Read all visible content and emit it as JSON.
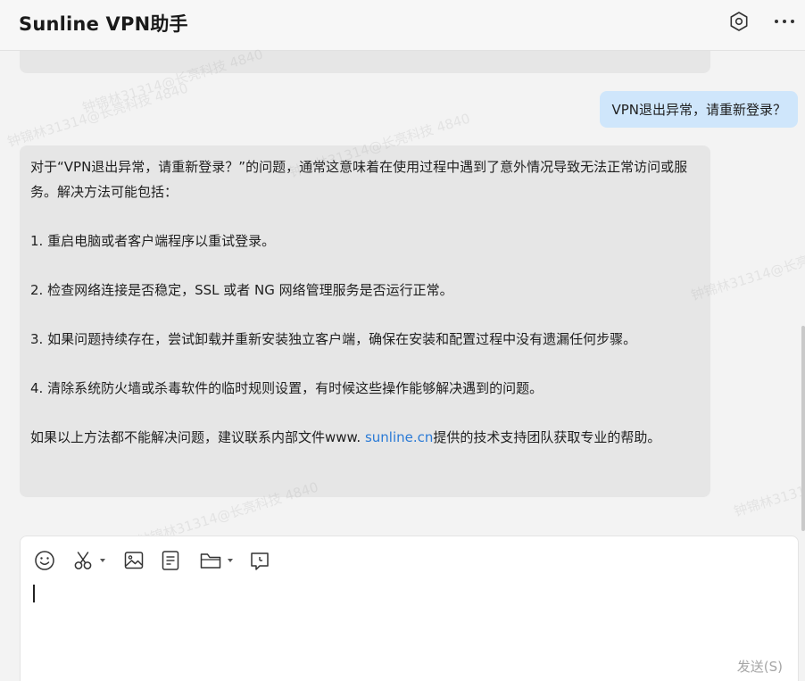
{
  "header": {
    "title": "Sunline VPN助手"
  },
  "watermark": {
    "text_a": "钟锦林31314@长亮科技 4840",
    "text_b": "钟锦林31314@长亮科技 4840"
  },
  "chat": {
    "user_message": "VPN退出异常，请重新登录？",
    "bot_reply": {
      "intro": "对于“VPN退出异常，请重新登录？”的问题，通常这意味着在使用过程中遇到了意外情况导致无法正常访问或服务。解决方法可能包括：",
      "step1": "1. 重启电脑或者客户端程序以重试登录。",
      "step2": "2. 检查网络连接是否稳定，SSL 或者 NG 网络管理服务是否运行正常。",
      "step3": "3. 如果问题持续存在，尝试卸载并重新安装独立客户端，确保在安装和配置过程中没有遗漏任何步骤。",
      "step4": "4. 清除系统防火墙或杀毒软件的临时规则设置，有时候这些操作能够解决遇到的问题。",
      "outro_prefix": "如果以上方法都不能解决问题，建议联系内部文件www. ",
      "outro_link": "sunline.cn",
      "outro_suffix": "提供的技术支持团队获取专业的帮助。"
    }
  },
  "composer": {
    "send_label": "发送(S)",
    "icons": [
      "emoji-icon",
      "scissors-icon",
      "image-icon",
      "document-icon",
      "folder-icon",
      "feedback-icon"
    ]
  },
  "colors": {
    "user_bubble": "#cfe6fb",
    "bot_bubble": "#e6e6e6",
    "link": "#2a7ad6"
  }
}
